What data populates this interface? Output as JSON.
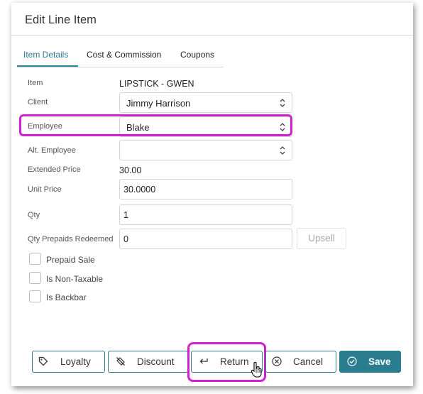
{
  "dialog": {
    "title": "Edit Line Item"
  },
  "tabs": [
    {
      "label": "Item Details",
      "active": true
    },
    {
      "label": "Cost & Commission",
      "active": false
    },
    {
      "label": "Coupons",
      "active": false
    }
  ],
  "form": {
    "item": {
      "label": "Item",
      "value": "LIPSTICK - GWEN"
    },
    "client": {
      "label": "Client",
      "value": "Jimmy Harrison"
    },
    "employee": {
      "label": "Employee",
      "value": "Blake"
    },
    "alt_employee": {
      "label": "Alt. Employee",
      "value": ""
    },
    "extended_price": {
      "label": "Extended Price",
      "value": "30.00"
    },
    "unit_price": {
      "label": "Unit Price",
      "value": "30.0000"
    },
    "qty": {
      "label": "Qty",
      "value": "1"
    },
    "qty_prepaids": {
      "label": "Qty Prepaids Redeemed",
      "value": "0"
    },
    "upsell_label": "Upsell"
  },
  "checkboxes": [
    {
      "label": "Prepaid Sale",
      "checked": false
    },
    {
      "label": "Is Non-Taxable",
      "checked": false
    },
    {
      "label": "Is Backbar",
      "checked": false
    }
  ],
  "buttons": {
    "loyalty": "Loyalty",
    "discount": "Discount",
    "return": "Return",
    "cancel": "Cancel",
    "save": "Save"
  },
  "colors": {
    "accent": "#2a7d8f",
    "highlight": "#d21fd1"
  }
}
